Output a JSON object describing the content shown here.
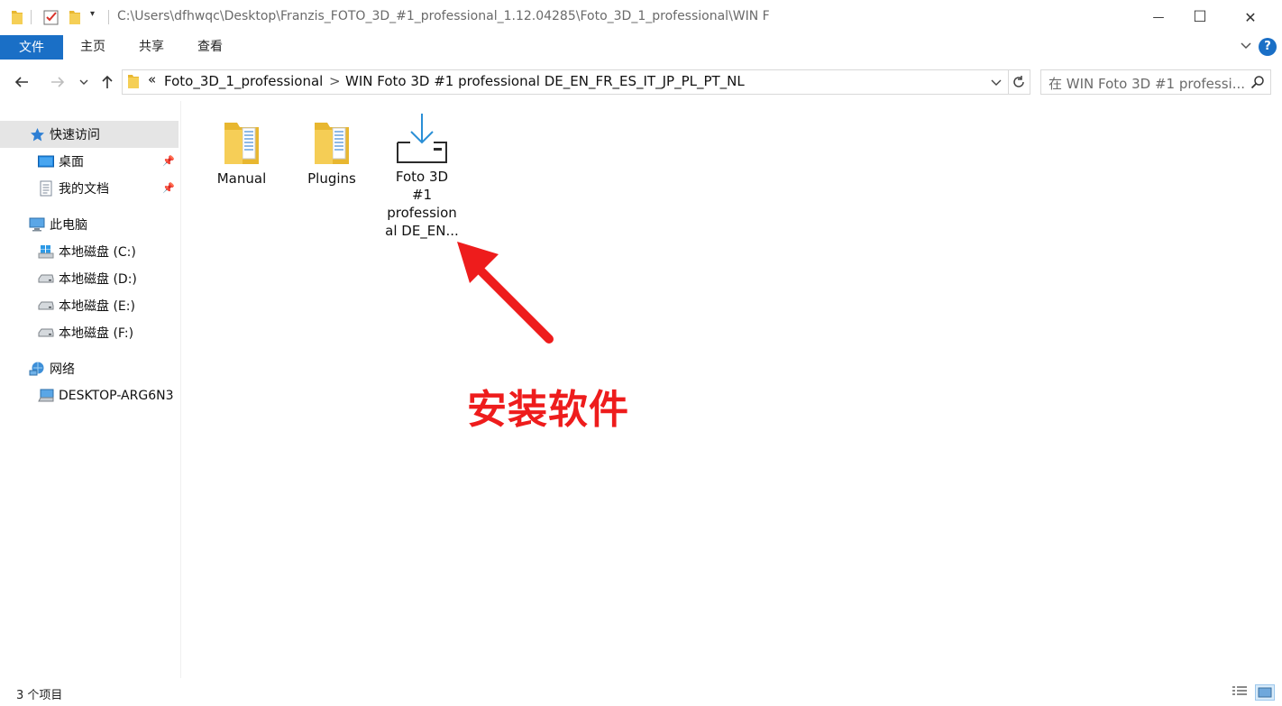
{
  "window": {
    "title": "C:\\Users\\dfhwqc\\Desktop\\Franzis_FOTO_3D_#1_professional_1.12.04285\\Foto_3D_1_professional\\WIN F",
    "minimize_glyph": "—",
    "maximize_glyph": "☐",
    "close_glyph": "✕"
  },
  "ribbon": {
    "tabs": [
      "文件",
      "主页",
      "共享",
      "查看"
    ],
    "expand_glyph": "⌄",
    "help_glyph": "?"
  },
  "address": {
    "overflow": "«",
    "crumbs": [
      "Foto_3D_1_professional",
      "WIN Foto 3D #1 professional DE_EN_FR_ES_IT_JP_PL_PT_NL"
    ],
    "separator": ">",
    "search_placeholder": "在 WIN Foto 3D #1 professi..."
  },
  "navpane": {
    "quick_access": "快速访问",
    "desktop": "桌面",
    "documents": "我的文档",
    "this_pc": "此电脑",
    "drives": [
      "本地磁盘 (C:)",
      "本地磁盘 (D:)",
      "本地磁盘 (E:)",
      "本地磁盘 (F:)"
    ],
    "network": "网络",
    "network_computer": "DESKTOP-ARG6N3"
  },
  "files": [
    {
      "name": "Manual",
      "icon": "folder-icon"
    },
    {
      "name": "Plugins",
      "icon": "folder-icon"
    },
    {
      "name": "Foto 3D #1 professional DE_EN...",
      "icon": "installer-icon"
    }
  ],
  "file_labels": {
    "installer_line1": "Foto 3D",
    "installer_line2": "#1",
    "installer_line3": "profession",
    "installer_line4": "al DE_EN..."
  },
  "annotation": {
    "text": "安装软件",
    "color": "#ee1c1c"
  },
  "status": {
    "item_count": "3 个项目"
  },
  "colors": {
    "accent": "#1a6fc6",
    "folder": "#f2c94c",
    "installer_arrow": "#2a8fd6"
  }
}
